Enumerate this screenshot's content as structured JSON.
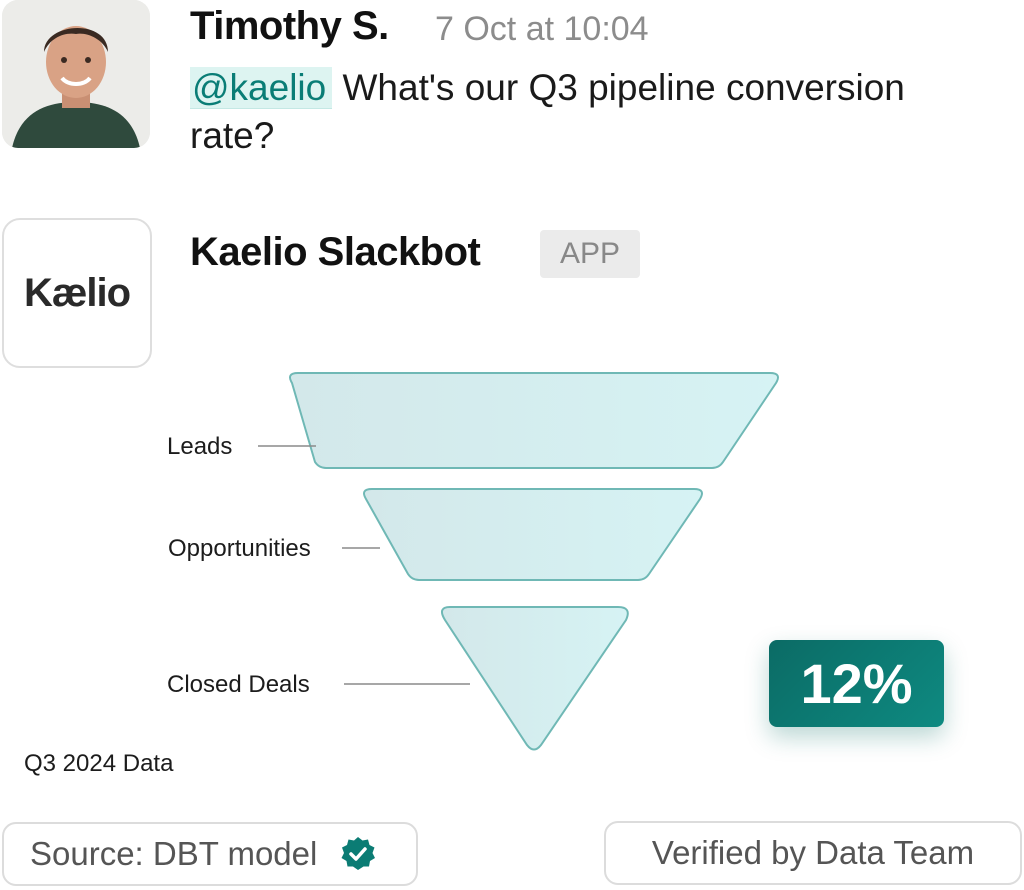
{
  "message": {
    "sender": "Timothy S.",
    "timestamp": "7 Oct at 10:04",
    "mention": "@kaelio",
    "text": " What's our Q3 pipeline conversion rate?"
  },
  "reply": {
    "logo_text": "Kælio",
    "bot_name": "Kaelio Slackbot",
    "badge": "APP"
  },
  "funnel": {
    "stages": [
      "Leads",
      "Opportunities",
      "Closed Deals"
    ],
    "period": "Q3 2024 Data",
    "conversion_rate": "12%"
  },
  "footer": {
    "source": "Source: DBT model",
    "verified": "Verified by Data Team"
  },
  "colors": {
    "accent": "#0b7c74",
    "mention_bg": "#ddf4f1",
    "funnel_fill": "#d6eef0",
    "funnel_stroke": "#6fb8b5"
  },
  "icons": {
    "verified": "verified-badge-icon"
  }
}
